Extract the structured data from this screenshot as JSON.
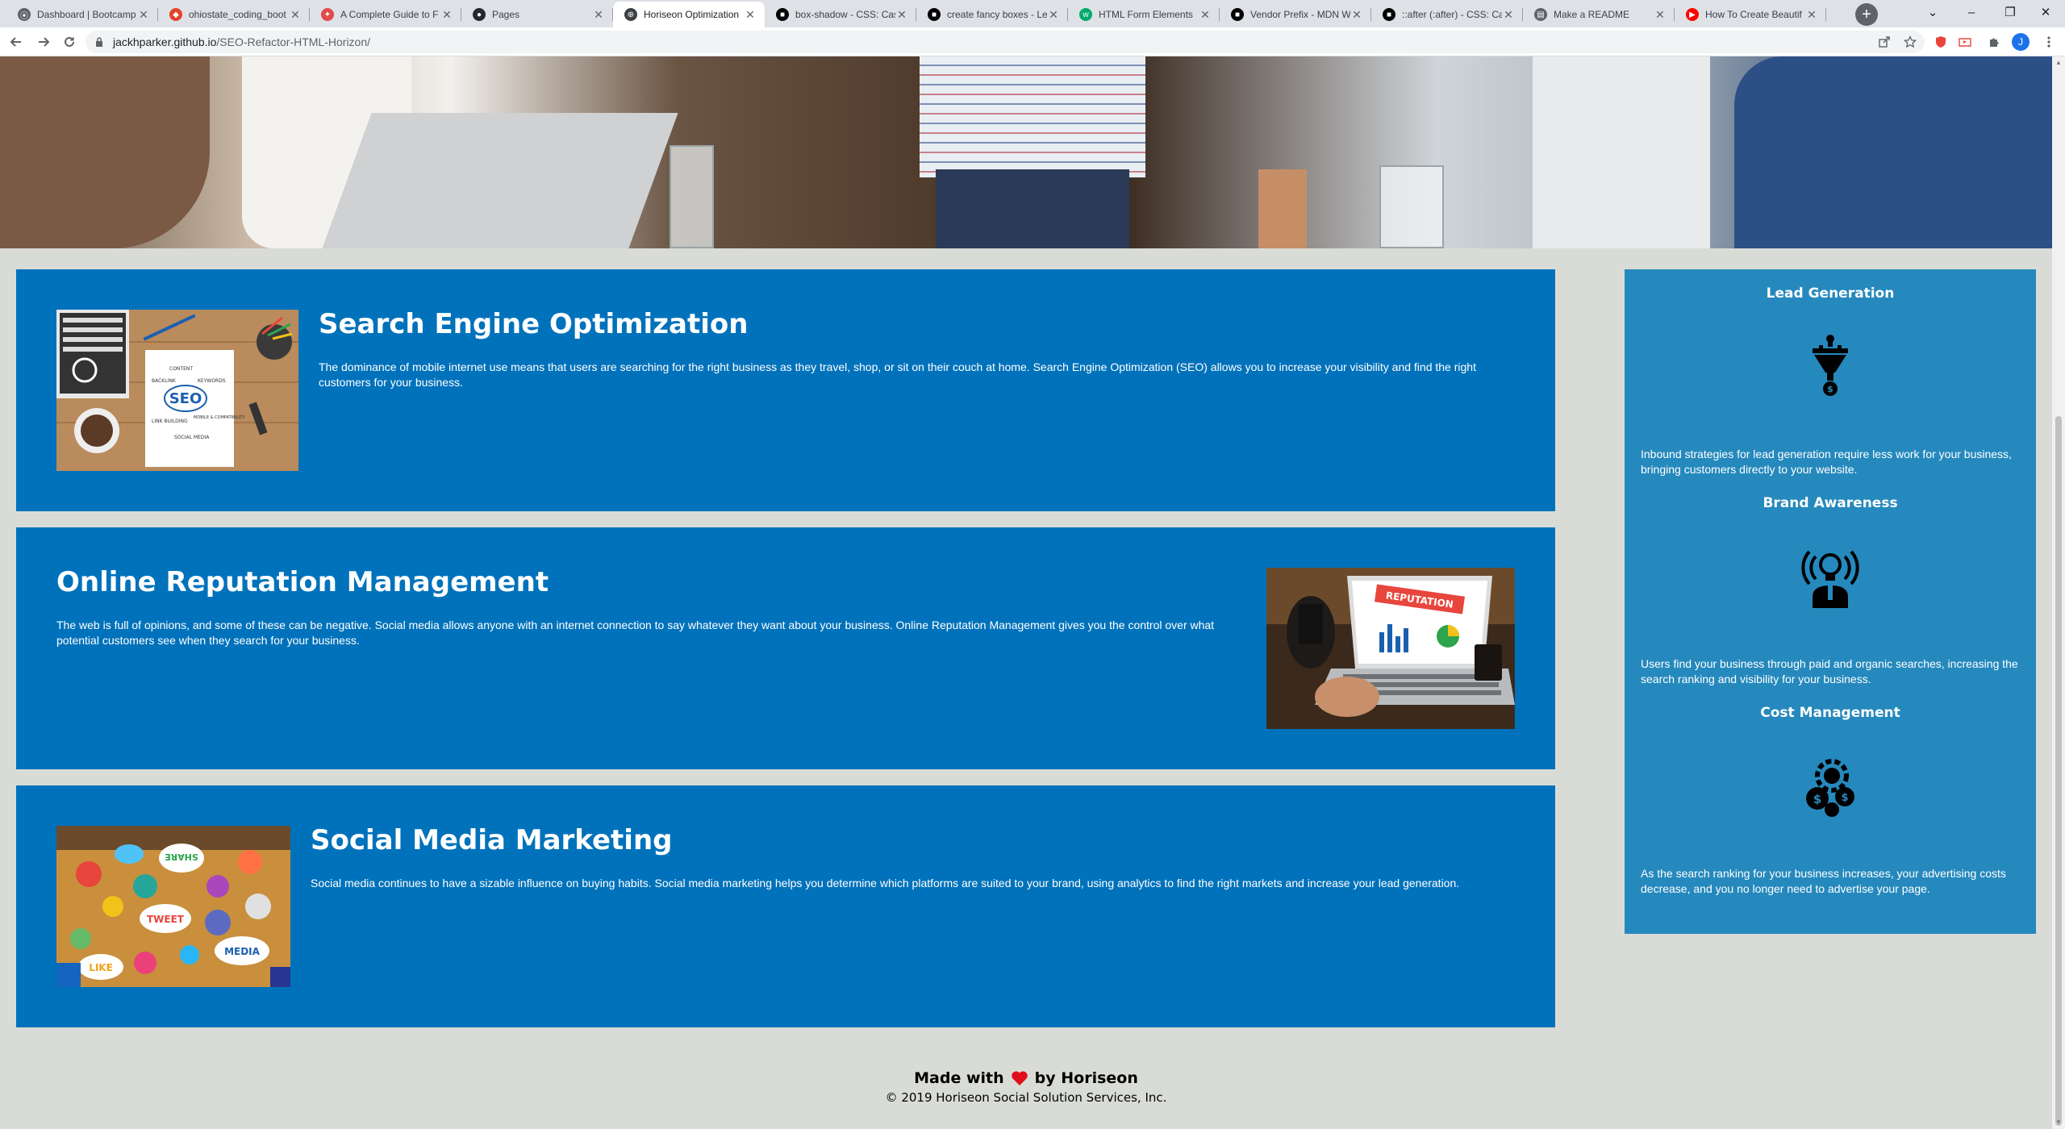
{
  "browser": {
    "tabs": [
      {
        "title": "Dashboard | Bootcamp",
        "favicon_color": "#5f6368",
        "favicon": "⦿"
      },
      {
        "title": "ohiostate_coding_boot",
        "favicon_color": "#e2432a",
        "favicon": "◆"
      },
      {
        "title": "A Complete Guide to F",
        "favicon_color": "#e24a4a",
        "favicon": "✦"
      },
      {
        "title": "Pages",
        "favicon_color": "#24292e",
        "favicon": "●"
      },
      {
        "title": "Horiseon Optimization",
        "favicon_color": "#3c4043",
        "favicon": "⊕",
        "active": true
      },
      {
        "title": "box-shadow - CSS: Cas",
        "favicon_color": "#000000",
        "favicon": "■"
      },
      {
        "title": "create fancy boxes - Le",
        "favicon_color": "#000000",
        "favicon": "■"
      },
      {
        "title": "HTML Form Elements",
        "favicon_color": "#04aa6d",
        "favicon": "w"
      },
      {
        "title": "Vendor Prefix - MDN W",
        "favicon_color": "#000000",
        "favicon": "■"
      },
      {
        "title": "::after (:after) - CSS: Cas",
        "favicon_color": "#000000",
        "favicon": "■"
      },
      {
        "title": "Make a README",
        "favicon_color": "#5f6368",
        "favicon": "▤"
      },
      {
        "title": "How To Create Beautif",
        "favicon_color": "#ff0000",
        "favicon": "▶"
      }
    ],
    "new_tab_glyph": "+",
    "window_controls": {
      "tab_search": "⌄",
      "minimize": "–",
      "restore": "❐",
      "close": "✕"
    },
    "url_host": "jackhparker.github.io",
    "url_path": "/SEO-Refactor-HTML-Horizon/",
    "profile_initial": "J"
  },
  "cards": [
    {
      "title": "Search Engine Optimization",
      "text": "The dominance of mobile internet use means that users are searching for the right business as they travel, shop, or sit on their couch at home. Search Engine Optimization (SEO) allows you to increase your visibility and find the right customers for your business."
    },
    {
      "title": "Online Reputation Management",
      "text": "The web is full of opinions, and some of these can be negative. Social media allows anyone with an internet connection to say whatever they want about your business. Online Reputation Management gives you the control over what potential customers see when they search for your business."
    },
    {
      "title": "Social Media Marketing",
      "text": "Social media continues to have a sizable influence on buying habits. Social media marketing helps you determine which platforms are suited to your brand, using analytics to find the right markets and increase your lead generation."
    }
  ],
  "images": {
    "seo_word": "SEO",
    "seo_labels": [
      "CONTENT",
      "BACKLINK",
      "KEYWORDS",
      "LINK BUILDING",
      "SOCIAL MEDIA",
      "MOBILE & COMPATIBILITY"
    ],
    "reputation_word": "REPUTATION",
    "social_words": [
      "SHARE",
      "TWEET",
      "LIKE",
      "MEDIA"
    ]
  },
  "benefits": [
    {
      "title": "Lead Generation",
      "icon": "funnel-dollar-icon",
      "text": "Inbound strategies for lead generation require less work for your business, bringing customers directly to your website."
    },
    {
      "title": "Brand Awareness",
      "icon": "lightbulb-person-icon",
      "text": "Users find your business through paid and organic searches, increasing the search ranking and visibility for your business."
    },
    {
      "title": "Cost Management",
      "icon": "gear-coins-icon",
      "text": "As the search ranking for your business increases, your advertising costs decrease, and you no longer need to advertise your page."
    }
  ],
  "footer": {
    "made_with": "Made with",
    "by": "by Horiseon",
    "copyright": "© 2019 Horiseon Social Solution Services, Inc."
  },
  "colors": {
    "card_bg": "#0072bb",
    "sidebar_bg": "#2589bd",
    "page_bg": "#d9dcd6",
    "heart": "#e10f1e"
  }
}
